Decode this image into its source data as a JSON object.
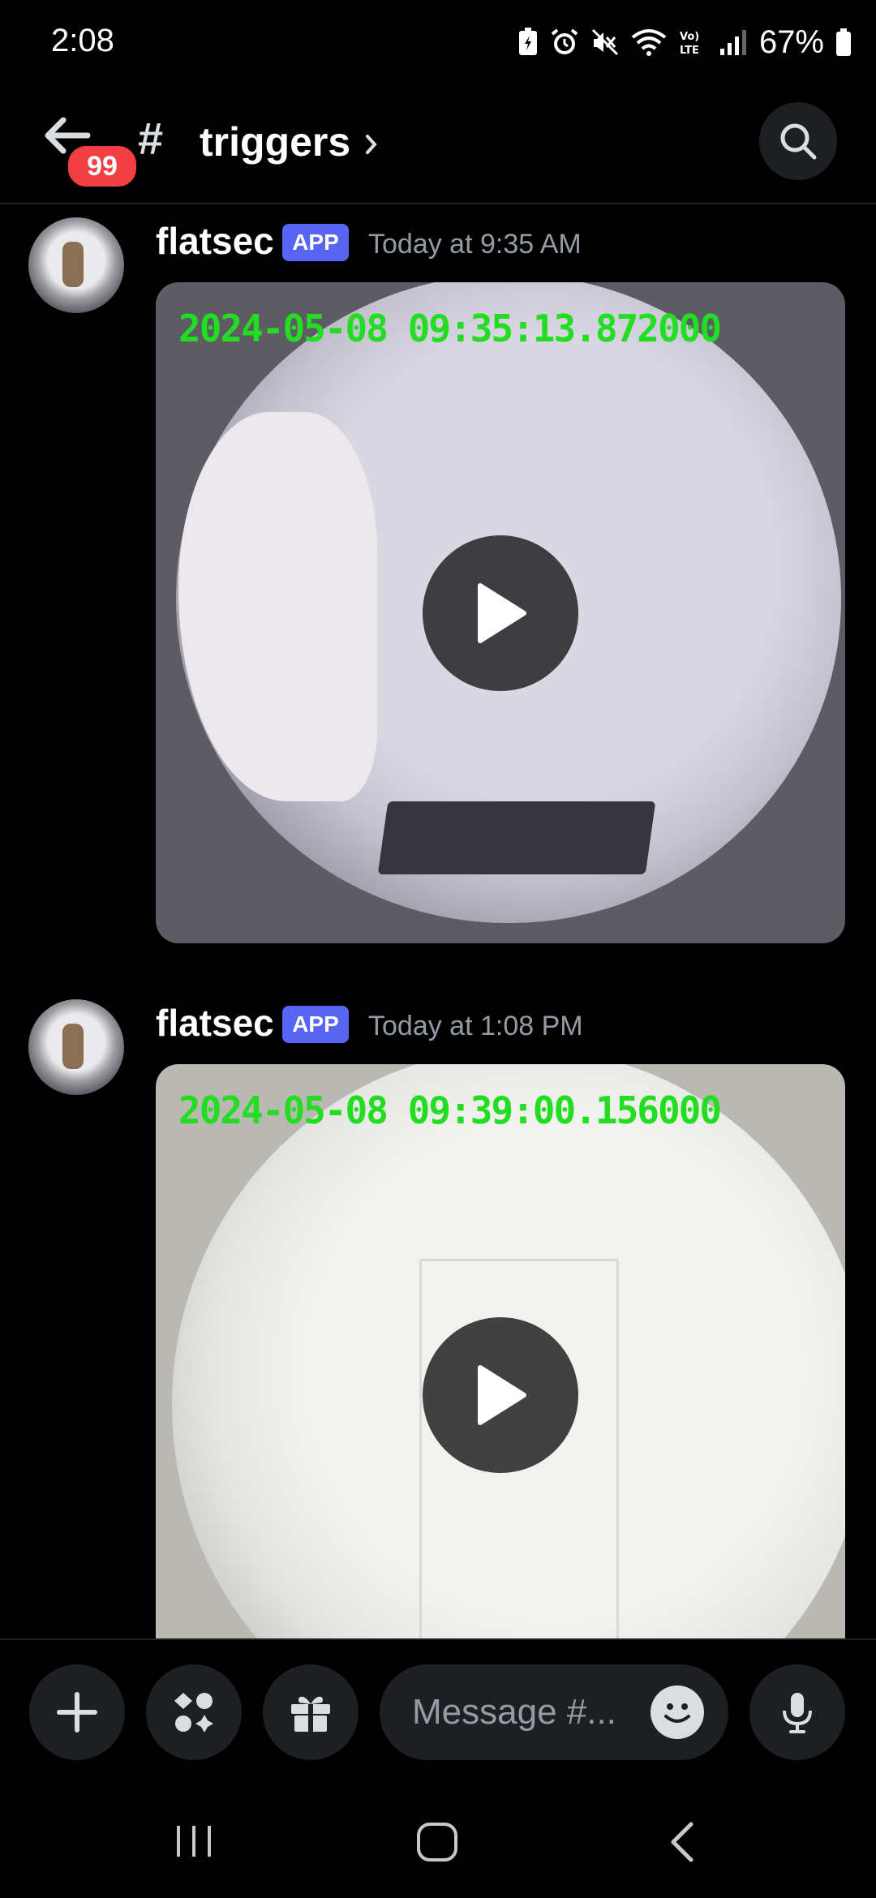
{
  "status_bar": {
    "time": "2:08",
    "battery": "67%",
    "icons": [
      "battery-saver-icon",
      "alarm-icon",
      "mute-icon",
      "wifi-icon",
      "volte-icon",
      "signal-icon",
      "battery-icon"
    ]
  },
  "header": {
    "unread_badge": "99",
    "channel_symbol": "#",
    "channel_name": "triggers"
  },
  "messages": [
    {
      "author": "flatsec",
      "tag": "APP",
      "timestamp": "Today at 9:35 AM",
      "video_overlay": "2024-05-08 09:35:13.872000"
    },
    {
      "author": "flatsec",
      "tag": "APP",
      "timestamp": "Today at 1:08 PM",
      "video_overlay": "2024-05-08 09:39:00.156000"
    }
  ],
  "composer": {
    "placeholder": "Message #..."
  },
  "colors": {
    "background": "#000000",
    "brand": "#5865f2",
    "badge": "#f23f43",
    "overlay_text": "#22dd22"
  }
}
